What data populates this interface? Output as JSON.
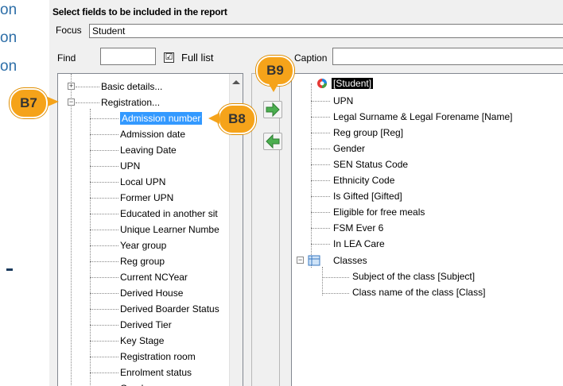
{
  "left_fragment": {
    "lines": [
      "on",
      "on",
      "on"
    ]
  },
  "dialog": {
    "title": "Select fields to be included in the report",
    "focus_label": "Focus",
    "focus_value": "Student",
    "find_label": "Find",
    "find_value": "",
    "full_list_label": "Full list",
    "full_list_checked": "☑",
    "caption_label": "Caption",
    "caption_value": ""
  },
  "left_tree": {
    "groups": [
      {
        "label": "Basic details...",
        "expander": "+"
      },
      {
        "label": "Registration...",
        "expander": "−"
      }
    ],
    "items": [
      "Admission number",
      "Admission date",
      "Leaving Date",
      "UPN",
      "Local UPN",
      "Former UPN",
      "Educated in another sit",
      "Unique Learner Numbe",
      "Year group",
      "Reg group",
      "Current NCYear",
      "Derived House",
      "Derived Boarder Status",
      "Derived Tier",
      "Key Stage",
      "Registration room",
      "Enrolment status",
      "Gender"
    ],
    "selected_item": "Admission number"
  },
  "right_tree": {
    "root": "[Student]",
    "fields": [
      "UPN",
      "Legal Surname & Legal Forename [Name]",
      "Reg group [Reg]",
      "Gender",
      "SEN Status Code",
      "Ethnicity Code",
      "Is Gifted [Gifted]",
      "Eligible for free meals",
      "FSM Ever 6",
      "In LEA Care"
    ],
    "group": {
      "label": "Classes",
      "expander": "−"
    },
    "group_fields": [
      "Subject of the class [Subject]",
      "Class name of the class [Class]"
    ]
  },
  "badges": {
    "b7": "B7",
    "b8": "B8",
    "b9": "B9"
  },
  "colors": {
    "badge": "#f5a31a",
    "selection": "#3399ff",
    "arrow_green": "#4caf50",
    "left_text": "#2e6fa8"
  },
  "icons": {
    "add": "arrow-right-icon",
    "remove": "arrow-left-icon",
    "root": "student-entity-icon",
    "classes": "table-icon"
  }
}
